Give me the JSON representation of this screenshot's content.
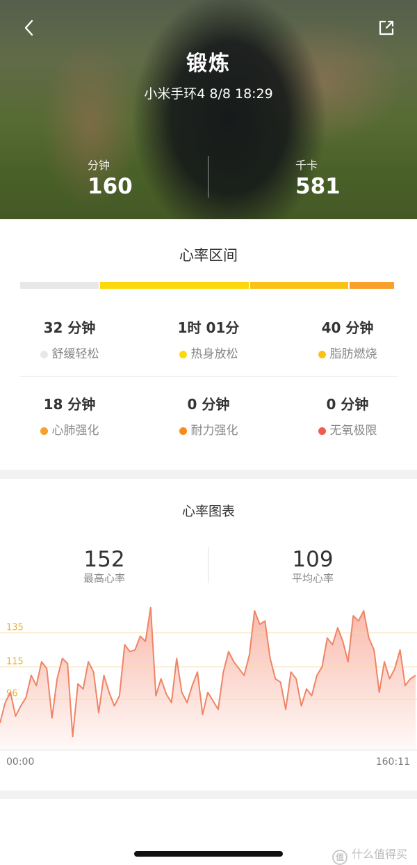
{
  "header": {
    "title": "锻炼",
    "subtitle": "小米手环4 8/8 18:29",
    "back_icon": "chevron-left-icon",
    "share_icon": "share-icon"
  },
  "summary": {
    "duration": {
      "label": "分钟",
      "value": "160"
    },
    "calories": {
      "label": "千卡",
      "value": "581"
    }
  },
  "zones": {
    "title": "心率区间",
    "bar_colors": [
      "#e8e8ea",
      "#fbd90d",
      "#fbc117",
      "#f99f2c"
    ],
    "bar_fractions": [
      0.2,
      0.38,
      0.25,
      0.11
    ],
    "items": [
      {
        "value": "32 分钟",
        "label": "舒缓轻松",
        "color": "#e7e7ea"
      },
      {
        "value": "1时 01分",
        "label": "热身放松",
        "color": "#fbd90d"
      },
      {
        "value": "40 分钟",
        "label": "脂肪燃烧",
        "color": "#fbc117"
      },
      {
        "value": "18 分钟",
        "label": "心肺强化",
        "color": "#f99f2c"
      },
      {
        "value": "0 分钟",
        "label": "耐力强化",
        "color": "#f88a1a"
      },
      {
        "value": "0 分钟",
        "label": "无氧极限",
        "color": "#f25c4e"
      }
    ]
  },
  "heart_chart": {
    "title": "心率图表",
    "max": {
      "value": "152",
      "label": "最高心率"
    },
    "avg": {
      "value": "109",
      "label": "平均心率"
    }
  },
  "chart_data": {
    "type": "area",
    "title": "心率图表",
    "xlabel": "",
    "ylabel": "",
    "x_start_label": "00:00",
    "x_end_label": "160:11",
    "xlim": [
      0,
      160
    ],
    "ylim": [
      66,
      154
    ],
    "reference_lines": [
      135,
      115,
      96
    ],
    "line_color": "#ef8466",
    "fill_color": "#f9b6a7",
    "grid": false,
    "series": [
      {
        "x": [
          0,
          2,
          4,
          6,
          8,
          10,
          12,
          14,
          16,
          18,
          20,
          22,
          24,
          26,
          28,
          30,
          32,
          34,
          36,
          38,
          40,
          42,
          44,
          46,
          48,
          50,
          52,
          54,
          56,
          58,
          60,
          62,
          64,
          66,
          68,
          70,
          72,
          74,
          76,
          78,
          80,
          82,
          84,
          86,
          88,
          90,
          92,
          94,
          96,
          98,
          100,
          102,
          104,
          106,
          108,
          110,
          112,
          114,
          116,
          118,
          120,
          122,
          124,
          126,
          128,
          130,
          132,
          134,
          136,
          138,
          140,
          142,
          144,
          146,
          148,
          150,
          152,
          154,
          156,
          158,
          160
        ],
        "values": [
          82,
          94,
          100,
          86,
          92,
          97,
          110,
          104,
          118,
          114,
          85,
          108,
          120,
          117,
          74,
          105,
          102,
          118,
          112,
          88,
          110,
          100,
          92,
          98,
          128,
          124,
          125,
          133,
          130,
          150,
          98,
          108,
          99,
          94,
          120,
          100,
          94,
          104,
          112,
          87,
          100,
          95,
          90,
          112,
          124,
          118,
          114,
          110,
          122,
          148,
          140,
          142,
          120,
          108,
          106,
          90,
          112,
          108,
          92,
          102,
          98,
          110,
          115,
          132,
          128,
          138,
          130,
          118,
          145,
          142,
          148,
          132,
          125,
          100,
          118,
          108,
          114,
          125,
          104,
          108,
          110
        ]
      }
    ]
  },
  "watermark": {
    "badge": "值",
    "text": "什么值得买"
  }
}
